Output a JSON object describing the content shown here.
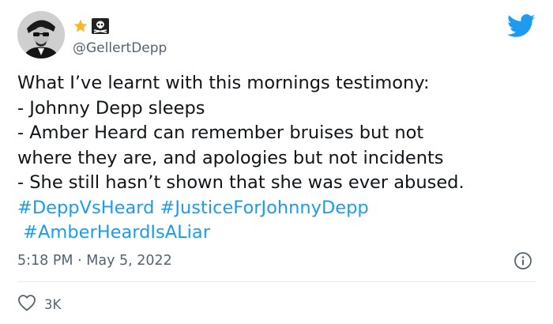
{
  "user": {
    "handle": "@GellertDepp",
    "avatar": "avatar-photo",
    "badges": [
      "star-icon",
      "skull-crossbones-icon"
    ]
  },
  "platform_icon": "twitter-bird-icon",
  "tweet": {
    "lines": [
      "What I’ve learnt with this mornings testimony:",
      "- Johnny Depp sleeps",
      "- Amber Heard can remember bruises but not",
      "where they are, and apologies but not incidents",
      "- She still hasn’t shown that she was ever abused."
    ],
    "hashtags": [
      "#DeppVsHeard",
      "#JusticeForJohnnyDepp",
      "#AmberHeardIsALiar"
    ]
  },
  "meta": {
    "time": "5:18 PM",
    "separator": "·",
    "date": "May 5, 2022"
  },
  "engagement": {
    "likes": "3K"
  },
  "colors": {
    "link": "#1d9bf0",
    "secondary_text": "#536471",
    "twitter_blue": "#1d9bf0"
  }
}
